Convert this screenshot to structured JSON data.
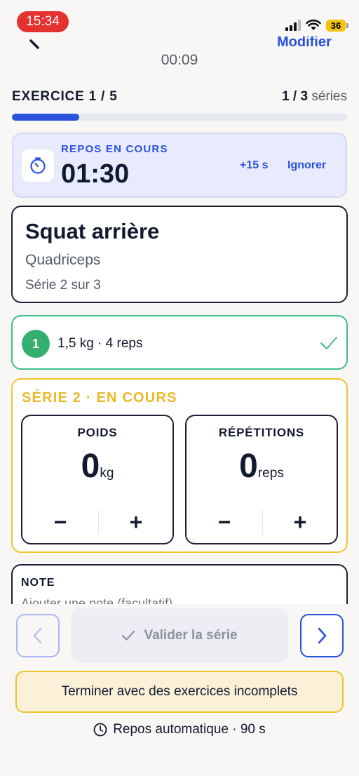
{
  "status_bar": {
    "time": "15:34",
    "battery": "36"
  },
  "header": {
    "elapsed": "00:09",
    "edit_label": "Modifier"
  },
  "progress": {
    "exercise_label": "EXERCICE 1 / 5",
    "series_current": "1 / 3",
    "series_word": "séries",
    "fraction": 0.2
  },
  "rest": {
    "title": "REPOS EN COURS",
    "remaining": "01:30",
    "add_label": "+15 s",
    "skip_label": "Ignorer"
  },
  "exercise": {
    "name": "Squat arrière",
    "muscle": "Quadriceps",
    "serie_text": "Série 2 sur 3"
  },
  "completed_set": {
    "number": "1",
    "summary": "1,5 kg · 4 reps"
  },
  "current_set": {
    "title": "SÉRIE 2 · EN COURS",
    "weight": {
      "label": "POIDS",
      "value": "0",
      "unit": "kg",
      "minus": "−",
      "plus": "+"
    },
    "reps": {
      "label": "RÉPÉTITIONS",
      "value": "0",
      "unit": "reps",
      "minus": "−",
      "plus": "+"
    }
  },
  "note": {
    "title": "NOTE",
    "placeholder": "Ajouter une note (facultatif)"
  },
  "actions": {
    "validate_label": "Valider la série",
    "finish_label": "Terminer avec des exercices incomplets",
    "auto_rest": "Repos automatique · 90 s"
  },
  "colors": {
    "accent": "#2b52dc",
    "success": "#33b06f",
    "warning": "#f0c42f",
    "danger": "#e5322f"
  }
}
